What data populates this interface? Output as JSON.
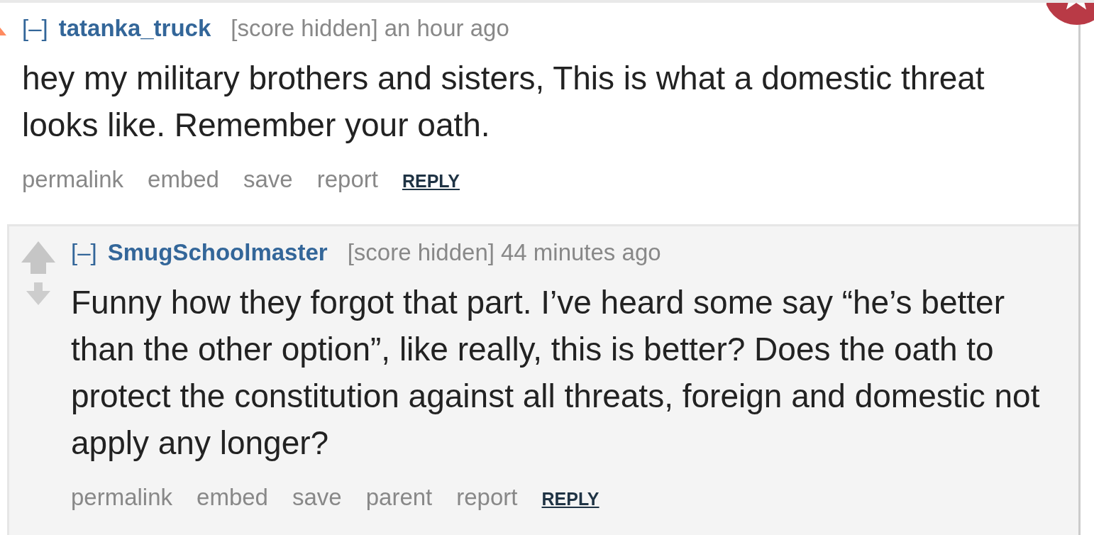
{
  "comments": [
    {
      "upvoted": true,
      "collapse": "[–]",
      "author": "tatanka_truck",
      "score": "[score hidden]",
      "time": "an hour ago",
      "text": "hey my military brothers and sisters, This is what a domestic threat looks like. Remember your oath.",
      "buttons": [
        {
          "label": "permalink",
          "kind": "link"
        },
        {
          "label": "embed",
          "kind": "link"
        },
        {
          "label": "save",
          "kind": "link"
        },
        {
          "label": "report",
          "kind": "link"
        },
        {
          "label": "REPLY",
          "kind": "reply"
        }
      ],
      "children": [
        {
          "upvoted": false,
          "collapse": "[–]",
          "author": "SmugSchoolmaster",
          "score": "[score hidden]",
          "time": "44 minutes ago",
          "text": "Funny how they forgot that part. I’ve heard some say “he’s better than the other option”, like really, this is better? Does the oath to protect the constitution against all threats, foreign and domestic not apply any longer?",
          "buttons": [
            {
              "label": "permalink",
              "kind": "link"
            },
            {
              "label": "embed",
              "kind": "link"
            },
            {
              "label": "save",
              "kind": "link"
            },
            {
              "label": "parent",
              "kind": "link"
            },
            {
              "label": "report",
              "kind": "link"
            },
            {
              "label": "REPLY",
              "kind": "reply"
            }
          ]
        }
      ]
    }
  ]
}
